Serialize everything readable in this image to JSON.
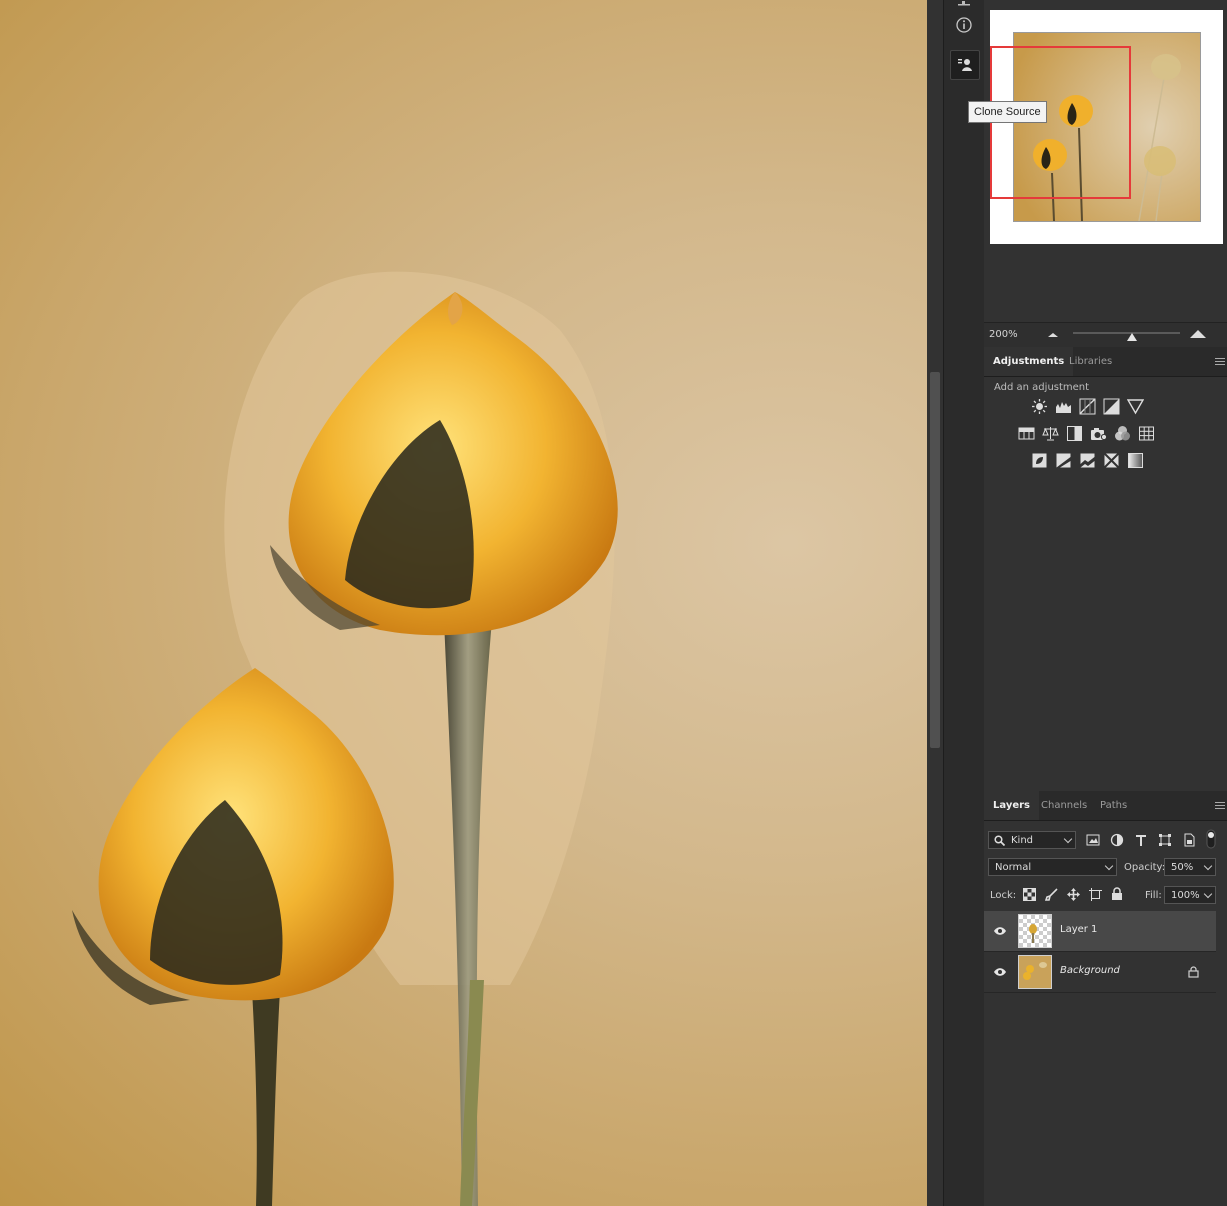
{
  "tooltip": {
    "text": "Clone Source"
  },
  "navigator": {
    "zoom": "200%"
  },
  "adjustments_panel": {
    "tabs": [
      "Adjustments",
      "Libraries"
    ],
    "active_tab": "Adjustments",
    "hint": "Add an adjustment",
    "rows": [
      [
        "brightness-contrast-icon",
        "levels-icon",
        "curves-icon",
        "exposure-icon",
        "vibrance-icon"
      ],
      [
        "hue-saturation-icon",
        "color-balance-icon",
        "black-white-icon",
        "photo-filter-icon",
        "channel-mixer-icon",
        "color-lookup-icon"
      ],
      [
        "invert-icon",
        "posterize-icon",
        "threshold-icon",
        "selective-color-icon",
        "gradient-map-icon"
      ]
    ]
  },
  "layers_panel": {
    "tabs": [
      "Layers",
      "Channels",
      "Paths"
    ],
    "active_tab": "Layers",
    "filter_kind": "Kind",
    "blend_mode": "Normal",
    "opacity_label": "Opacity:",
    "opacity_value": "50%",
    "lock_label": "Lock:",
    "fill_label": "Fill:",
    "fill_value": "100%",
    "layers": [
      {
        "name": "Layer 1",
        "visible": true,
        "selected": true,
        "locked": false
      },
      {
        "name": "Background",
        "visible": true,
        "selected": false,
        "locked": true
      }
    ]
  },
  "icon_strip": [
    "info-icon",
    "clone-source-icon"
  ],
  "colors": {
    "accent_red": "#e53a3a",
    "panel_bg": "#323232",
    "canvas_tone": "#c9a66a"
  }
}
